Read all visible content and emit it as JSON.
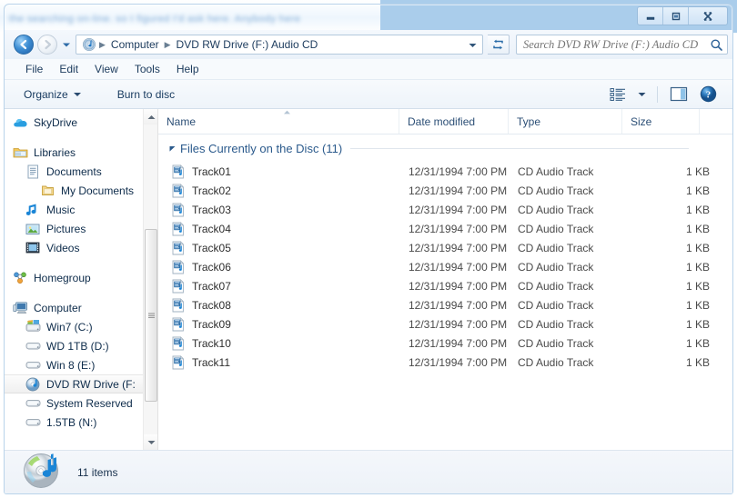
{
  "desktop": {
    "blurred_background_text": "the searching on-line. so I figured I'd ask here. Anybody here"
  },
  "window": {
    "controls": {
      "minimize": "Minimize",
      "maximize": "Maximize",
      "close": "Close"
    }
  },
  "addressbar": {
    "back_label": "Back",
    "forward_label": "Forward",
    "history_label": "Recent pages",
    "breadcrumbs": [
      {
        "label": "Computer"
      },
      {
        "label": "DVD RW Drive (F:) Audio CD"
      }
    ],
    "dropdown_label": "Previous locations",
    "refresh_label": "Refresh"
  },
  "search": {
    "placeholder": "Search DVD RW Drive (F:) Audio CD",
    "value": "",
    "icon": "search-icon"
  },
  "menubar": {
    "items": [
      {
        "label": "File"
      },
      {
        "label": "Edit"
      },
      {
        "label": "View"
      },
      {
        "label": "Tools"
      },
      {
        "label": "Help"
      }
    ]
  },
  "toolbar": {
    "organize_label": "Organize",
    "burn_label": "Burn to disc",
    "view_icon": "list-view-icon",
    "view_dropdown_icon": "chevron-down-icon",
    "preview_pane_icon": "preview-pane-icon",
    "help_icon": "help-icon"
  },
  "navpane": {
    "items": [
      {
        "label": "SkyDrive",
        "icon": "skydrive-cloud-icon",
        "indent": 0,
        "selected": false
      },
      {
        "label": "",
        "icon": "",
        "indent": 0,
        "spacer": true
      },
      {
        "label": "Libraries",
        "icon": "library-folder-icon",
        "indent": 0,
        "selected": false
      },
      {
        "label": "Documents",
        "icon": "documents-library-icon",
        "indent": 1,
        "selected": false
      },
      {
        "label": "My Documents",
        "icon": "folder-icon",
        "indent": 2,
        "selected": false
      },
      {
        "label": "Music",
        "icon": "music-note-icon",
        "indent": 1,
        "selected": false
      },
      {
        "label": "Pictures",
        "icon": "pictures-icon",
        "indent": 1,
        "selected": false
      },
      {
        "label": "Videos",
        "icon": "videos-filmstrip-icon",
        "indent": 1,
        "selected": false
      },
      {
        "label": "",
        "icon": "",
        "indent": 0,
        "spacer": true
      },
      {
        "label": "Homegroup",
        "icon": "homegroup-icon",
        "indent": 0,
        "selected": false
      },
      {
        "label": "",
        "icon": "",
        "indent": 0,
        "spacer": true
      },
      {
        "label": "Computer",
        "icon": "computer-icon",
        "indent": 0,
        "selected": false
      },
      {
        "label": "Win7 (C:)",
        "icon": "windows-drive-icon",
        "indent": 1,
        "selected": false
      },
      {
        "label": "WD 1TB (D:)",
        "icon": "hard-drive-icon",
        "indent": 1,
        "selected": false
      },
      {
        "label": "Win 8 (E:)",
        "icon": "hard-drive-icon",
        "indent": 1,
        "selected": false
      },
      {
        "label": "DVD RW Drive (F:",
        "icon": "dvd-drive-icon",
        "indent": 1,
        "selected": true
      },
      {
        "label": "System Reserved",
        "icon": "hard-drive-icon",
        "indent": 1,
        "selected": false
      },
      {
        "label": "1.5TB (N:)",
        "icon": "hard-drive-icon",
        "indent": 1,
        "selected": false
      }
    ],
    "scrollbar": {
      "up_arrow": "scroll-up-arrow",
      "down_arrow": "scroll-down-arrow"
    }
  },
  "filelist": {
    "columns": [
      {
        "label": "Name",
        "sorted": "ascending"
      },
      {
        "label": "Date modified",
        "sorted": ""
      },
      {
        "label": "Type",
        "sorted": ""
      },
      {
        "label": "Size",
        "sorted": ""
      }
    ],
    "group": {
      "label": "Files Currently on the Disc (11)",
      "collapse_icon": "triangle-down-icon"
    },
    "rows": [
      {
        "name": "Track01",
        "date": "12/31/1994 7:00 PM",
        "type": "CD Audio Track",
        "size": "1 KB",
        "icon": "cd-audio-track-icon"
      },
      {
        "name": "Track02",
        "date": "12/31/1994 7:00 PM",
        "type": "CD Audio Track",
        "size": "1 KB",
        "icon": "cd-audio-track-icon"
      },
      {
        "name": "Track03",
        "date": "12/31/1994 7:00 PM",
        "type": "CD Audio Track",
        "size": "1 KB",
        "icon": "cd-audio-track-icon"
      },
      {
        "name": "Track04",
        "date": "12/31/1994 7:00 PM",
        "type": "CD Audio Track",
        "size": "1 KB",
        "icon": "cd-audio-track-icon"
      },
      {
        "name": "Track05",
        "date": "12/31/1994 7:00 PM",
        "type": "CD Audio Track",
        "size": "1 KB",
        "icon": "cd-audio-track-icon"
      },
      {
        "name": "Track06",
        "date": "12/31/1994 7:00 PM",
        "type": "CD Audio Track",
        "size": "1 KB",
        "icon": "cd-audio-track-icon"
      },
      {
        "name": "Track07",
        "date": "12/31/1994 7:00 PM",
        "type": "CD Audio Track",
        "size": "1 KB",
        "icon": "cd-audio-track-icon"
      },
      {
        "name": "Track08",
        "date": "12/31/1994 7:00 PM",
        "type": "CD Audio Track",
        "size": "1 KB",
        "icon": "cd-audio-track-icon"
      },
      {
        "name": "Track09",
        "date": "12/31/1994 7:00 PM",
        "type": "CD Audio Track",
        "size": "1 KB",
        "icon": "cd-audio-track-icon"
      },
      {
        "name": "Track10",
        "date": "12/31/1994 7:00 PM",
        "type": "CD Audio Track",
        "size": "1 KB",
        "icon": "cd-audio-track-icon"
      },
      {
        "name": "Track11",
        "date": "12/31/1994 7:00 PM",
        "type": "CD Audio Track",
        "size": "1 KB",
        "icon": "cd-audio-track-icon"
      }
    ]
  },
  "statusbar": {
    "icon": "audio-cd-icon",
    "text": "11 items"
  },
  "colors": {
    "accent_blue": "#2b5a8c",
    "title_glass": "#aacdeb",
    "selection": "#f0f0f0",
    "text_primary": "#2e2e2e",
    "text_link": "#1b3a5c"
  }
}
